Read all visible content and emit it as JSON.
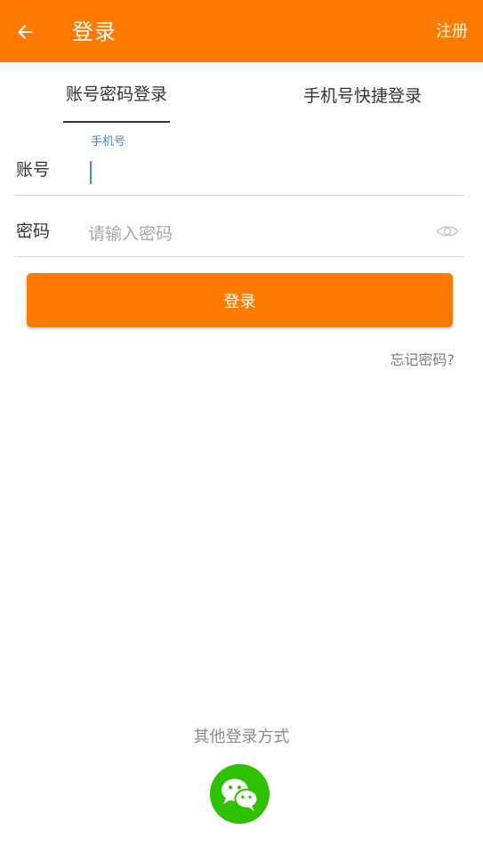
{
  "appbar": {
    "title": "登录",
    "register_label": "注册",
    "back_icon": "arrow-left-icon",
    "background_color": "#ff7a00"
  },
  "tabs": [
    {
      "label": "账号密码登录",
      "selected": true
    },
    {
      "label": "手机号快捷登录",
      "selected": false
    }
  ],
  "form": {
    "account": {
      "label": "账号",
      "floating_hint": "手机号",
      "value": "",
      "placeholder": ""
    },
    "password": {
      "label": "密码",
      "value": "",
      "placeholder": "请输入密码",
      "visibility_icon": "eye-icon"
    },
    "login_button_label": "登录",
    "forgot_password_label": "忘记密码?"
  },
  "other_login": {
    "title": "其他登录方式",
    "wechat_icon": "wechat-icon",
    "wechat_color": "#2dc100"
  }
}
